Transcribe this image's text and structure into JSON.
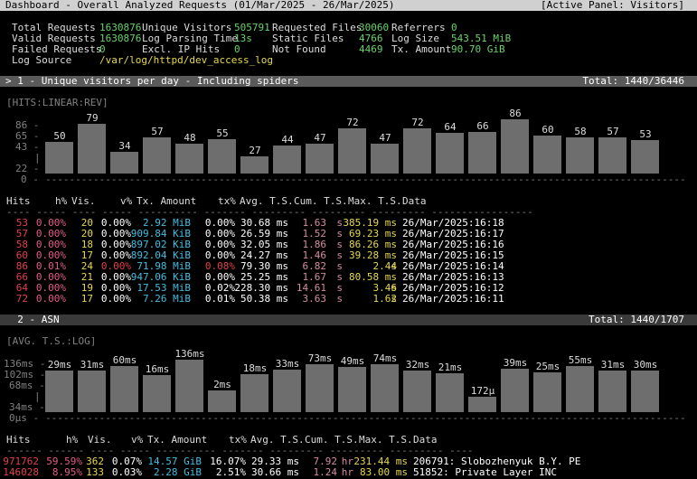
{
  "header": {
    "title": "Dashboard - Overall Analyzed Requests (01/Mar/2025 - 26/Mar/2025)",
    "active_panel": "[Active Panel: Visitors]"
  },
  "overview": {
    "total_requests_label": "Total Requests",
    "total_requests": "1630876",
    "unique_visitors_label": "Unique Visitors",
    "unique_visitors": "505791",
    "requested_files_label": "Requested Files",
    "requested_files": "30060",
    "referrers_label": "Referrers",
    "referrers": "0",
    "valid_requests_label": "Valid Requests",
    "valid_requests": "1630876",
    "log_parsing_time_label": "Log Parsing Time",
    "log_parsing_time": "13s",
    "static_files_label": "Static Files",
    "static_files": "4766",
    "log_size_label": "Log Size",
    "log_size": "543.51 MiB",
    "failed_requests_label": "Failed Requests",
    "failed_requests": "0",
    "excl_ip_hits_label": "Excl. IP Hits",
    "excl_ip_hits": "0",
    "not_found_label": "Not Found",
    "not_found": "4469",
    "tx_amount_label": "Tx. Amount",
    "tx_amount": "90.70 GiB",
    "log_source_label": "Log Source",
    "log_source": "/var/log/httpd/dev_access_log"
  },
  "panel1": {
    "title": "> 1 - Unique visitors per day - Including spiders",
    "total": "Total: 1440/36446",
    "scale_label": "[HITS:LINEAR:REV]",
    "y_ticks": [
      "86 -",
      "65 -",
      "43 -",
      "22 -",
      "0 -"
    ],
    "bar_values": [
      "50",
      "79",
      "34",
      "57",
      "48",
      "55",
      "27",
      "44",
      "47",
      "72",
      "47",
      "72",
      "64",
      "66",
      "86",
      "60",
      "58",
      "57",
      "53"
    ],
    "columns": {
      "hits": "Hits",
      "hpct": "h%",
      "vis": "Vis.",
      "vpct": "v%",
      "tx": "Tx. Amount",
      "txpct": "tx%",
      "avg": "Avg. T.S.",
      "cum": "Cum. T.S.",
      "max": "Max. T.S.",
      "data": "Data"
    },
    "rows": [
      {
        "hits": "53",
        "hpct": "0.00%",
        "vis": "20",
        "vpct": "0.00%",
        "tx": "2.92 MiB",
        "txpct": "0.00%",
        "avg": "30.68 ms",
        "cum": "1.63",
        "cum_unit": "s",
        "max": "385.19 ms",
        "data": "26/Mar/2025:16:18"
      },
      {
        "hits": "57",
        "hpct": "0.00%",
        "vis": "20",
        "vpct": "0.00%",
        "tx": "909.84 KiB",
        "txpct": "0.00%",
        "avg": "26.59 ms",
        "cum": "1.52",
        "cum_unit": "s",
        "max": "69.23 ms",
        "data": "26/Mar/2025:16:17"
      },
      {
        "hits": "58",
        "hpct": "0.00%",
        "vis": "18",
        "vpct": "0.00%",
        "tx": "897.02 KiB",
        "txpct": "0.00%",
        "avg": "32.05 ms",
        "cum": "1.86",
        "cum_unit": "s",
        "max": "86.26 ms",
        "data": "26/Mar/2025:16:16"
      },
      {
        "hits": "60",
        "hpct": "0.00%",
        "vis": "17",
        "vpct": "0.00%",
        "tx": "892.04 KiB",
        "txpct": "0.00%",
        "avg": "24.27 ms",
        "cum": "1.46",
        "cum_unit": "s",
        "max": "39.28 ms",
        "data": "26/Mar/2025:16:15"
      },
      {
        "hits": "86",
        "hpct": "0.01%",
        "vis": "24",
        "vpct": "0.00%",
        "tx": "71.98 MiB",
        "txpct": "0.08%",
        "avg": "79.30 ms",
        "cum": "6.82",
        "cum_unit": "s",
        "max": "2.44",
        "max_unit": "s",
        "data": "26/Mar/2025:16:14",
        "highlight": true
      },
      {
        "hits": "66",
        "hpct": "0.00%",
        "vis": "21",
        "vpct": "0.00%",
        "tx": "947.06 KiB",
        "txpct": "0.00%",
        "avg": "25.25 ms",
        "cum": "1.67",
        "cum_unit": "s",
        "max": "80.58 ms",
        "data": "26/Mar/2025:16:13"
      },
      {
        "hits": "64",
        "hpct": "0.00%",
        "vis": "19",
        "vpct": "0.00%",
        "tx": "17.53 MiB",
        "txpct": "0.02%",
        "avg": "228.30 ms",
        "cum": "14.61",
        "cum_unit": "s",
        "max": "3.46",
        "max_unit": "s",
        "data": "26/Mar/2025:16:12"
      },
      {
        "hits": "72",
        "hpct": "0.00%",
        "vis": "17",
        "vpct": "0.00%",
        "tx": "7.26 MiB",
        "txpct": "0.01%",
        "avg": "50.38 ms",
        "cum": "3.63",
        "cum_unit": "s",
        "max": "1.62",
        "max_unit": "s",
        "data": "26/Mar/2025:16:11"
      }
    ]
  },
  "panel2": {
    "title": "  2 - ASN",
    "total": "Total: 1440/1707",
    "scale_label": "[AVG. T.S.:LOG]",
    "y_ticks": [
      "136ms -",
      "102ms -",
      "68ms -",
      "34ms -",
      "0µs -"
    ],
    "bar_values": [
      "29ms",
      "31ms",
      "60ms",
      "16ms",
      "136ms",
      "2ms",
      "18ms",
      "33ms",
      "73ms",
      "49ms",
      "74ms",
      "32ms",
      "21ms",
      "172µ",
      "39ms",
      "25ms",
      "55ms",
      "31ms",
      "30ms"
    ],
    "columns": {
      "hits": "Hits",
      "hpct": "h%",
      "vis": "Vis.",
      "vpct": "v%",
      "tx": "Tx. Amount",
      "txpct": "tx%",
      "avg": "Avg. T.S.",
      "cum": "Cum. T.S.",
      "max": "Max. T.S.",
      "data": "Data"
    },
    "rows": [
      {
        "hits": "971762",
        "hpct": "59.59%",
        "vis": "362",
        "vpct": "0.07%",
        "tx": "14.57 GiB",
        "txpct": "16.07%",
        "avg": "29.33 ms",
        "cum": "7.92",
        "cum_unit": "hr",
        "max": "231.44 ms",
        "data": "206791: Slobozhenyuk B.Y. PE"
      },
      {
        "hits": "146028",
        "hpct": "8.95%",
        "vis": "133",
        "vpct": "0.03%",
        "tx": "2.28 GiB",
        "txpct": "2.51%",
        "avg": "30.66 ms",
        "cum": "1.24",
        "cum_unit": "hr",
        "max": "83.00 ms",
        "data": "51852: Private Layer INC"
      }
    ]
  }
}
